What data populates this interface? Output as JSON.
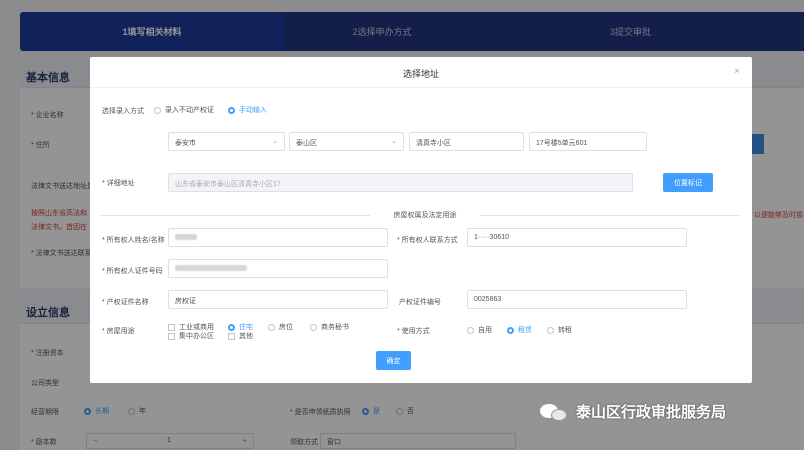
{
  "steps": [
    "1填写相关材料",
    "2选择申办方式",
    "3提交审批"
  ],
  "background": {
    "section_basic": "基本信息",
    "section_setup": "设立信息",
    "labels": {
      "company_name": "* 企业名称",
      "residence": "* 住所",
      "legal_doc_addr": "法律文书送达地址是",
      "legal_doc_contact": "* 法律文书送达联系",
      "reg_capital": "* 注册资本",
      "company_type": "公司类型",
      "term": "经营期限",
      "term_long": "长期",
      "term_year": "年",
      "copies": "* 副本数",
      "copies_value": "1",
      "copies_minus": "−",
      "copies_plus": "+",
      "apply_unit": "* 是否申领纸质执照",
      "yes": "是",
      "no": "否",
      "receive": "领取方式",
      "receive_value": "窗口"
    },
    "warning_left_1": "按照山东省高法和",
    "warning_left_2": "法律文书。首因在",
    "warning_right": "以便能够及时接"
  },
  "modal": {
    "title": "选择地址",
    "close": "×",
    "entry_method": {
      "label": "选择录入方式",
      "options": [
        "录入不动产权证",
        "手动输入"
      ],
      "selected": "手动输入"
    },
    "address": {
      "city": "泰安市",
      "district": "泰山区",
      "community": "清真寺小区",
      "unit": "17号楼5单元601"
    },
    "detail_address": {
      "label": "* 详细地址",
      "value": "山东省泰安市泰山区清真寺小区17",
      "locate_button": "位置标记"
    },
    "section_title": "房屋权属及法定用途",
    "owner_name": {
      "label": "* 所有权人姓名/名称",
      "value": ""
    },
    "owner_phone": {
      "label": "* 所有权人联系方式",
      "value": "1·····30610"
    },
    "owner_id": {
      "label": "* 所有权人证件号码",
      "value": ""
    },
    "cert_name": {
      "label": "* 产权证件名称",
      "value": "房权证"
    },
    "cert_no": {
      "label": "产权证件编号",
      "value": "0025863"
    },
    "house_use": {
      "label": "* 房屋用途",
      "options": [
        "工业或商用",
        "住宅",
        "房位",
        "商务秘书",
        "集中办公区",
        "其他"
      ],
      "selected": "住宅"
    },
    "use_method": {
      "label": "* 使用方式",
      "options": [
        "自用",
        "租赁",
        "转租"
      ],
      "selected": "租赁"
    },
    "confirm": "确定"
  },
  "watermark": "泰山区行政审批服务局"
}
